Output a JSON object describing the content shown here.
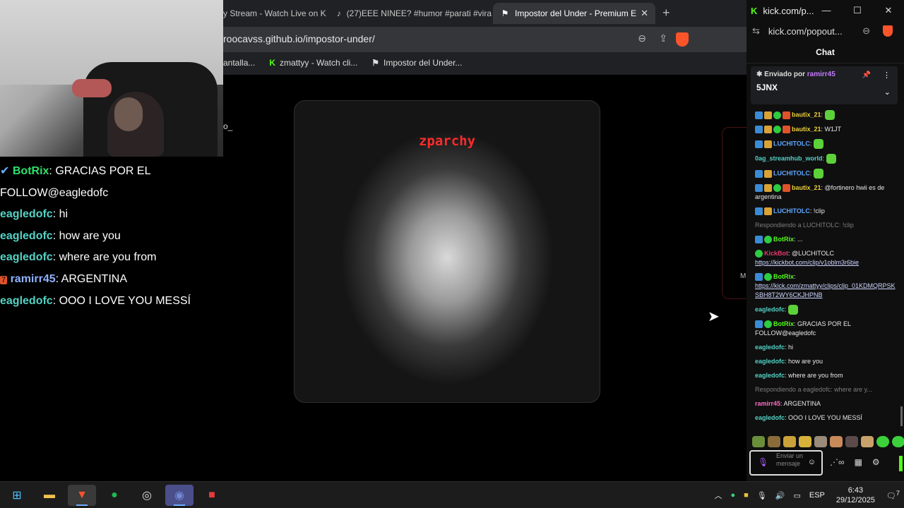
{
  "browser": {
    "tabs": [
      {
        "label": "y Stream - Watch Live on K",
        "icon": "kick-icon"
      },
      {
        "label": "(27)EEE NINEE? #humor #parati #vira",
        "icon": "tiktok-icon"
      },
      {
        "label": "Impostor del Under - Premium E",
        "icon": "game-icon",
        "active": true
      }
    ],
    "url": "roocavss.github.io/impostor-under/",
    "bookmarks": [
      {
        "label": "antalla...",
        "icon": ""
      },
      {
        "label": "zmattyy - Watch cli...",
        "icon": "K"
      },
      {
        "label": "Impostor del Under...",
        "icon": "game-icon"
      }
    ]
  },
  "stray_text": "o_",
  "overlay_chat": [
    {
      "user": "BotRix",
      "prefix": "✔",
      "msg": "GRACIAS POR EL FOLLOW@eagledofc",
      "style": "u2"
    },
    {
      "user": "eagledofc",
      "msg": "hi",
      "style": "u"
    },
    {
      "user": "eagledofc",
      "msg": "how are you",
      "style": "u"
    },
    {
      "user": "eagledofc",
      "msg": "where are you from",
      "style": "u"
    },
    {
      "user": "ramirr45",
      "prefix": "7",
      "msg": "ARGENTINA",
      "style": "u3"
    },
    {
      "user": "eagledofc",
      "msg": "OOO I LOVE YOU MESSÍ",
      "style": "u"
    }
  ],
  "game": {
    "title": "zparchy"
  },
  "ghost_letter": "M",
  "chat_window": {
    "title": "kick.com/p...",
    "address": "kick.com/popout...",
    "header": "Chat",
    "pinned": {
      "sent_by_label": "Enviado por",
      "user": "ramirr45",
      "text": "5JNX"
    },
    "messages": [
      {
        "user": "bautix_21",
        "text": "",
        "color": "n-y",
        "badges": [
          "blue",
          "gold",
          "green",
          "red"
        ],
        "emote": true
      },
      {
        "user": "bautix_21",
        "text": "W1JT",
        "color": "n-y",
        "badges": [
          "blue",
          "gold",
          "green",
          "red"
        ]
      },
      {
        "user": "LUCHITOLC",
        "text": "",
        "color": "n-b",
        "badges": [
          "blue",
          "gold"
        ],
        "emote": true
      },
      {
        "user": "0ag_streamhub_world",
        "text": "",
        "color": "n-t",
        "badges": [],
        "emote": true
      },
      {
        "user": "LUCHITOLC",
        "text": "",
        "color": "n-b",
        "badges": [
          "blue",
          "gold"
        ],
        "emote": true
      },
      {
        "user": "bautix_21",
        "text": "@fortinero hwii es de argentina",
        "color": "n-y",
        "badges": [
          "blue",
          "gold",
          "green",
          "red"
        ]
      },
      {
        "user": "LUCHITOLC",
        "text": "!clip",
        "color": "n-b",
        "badges": [
          "blue",
          "gold"
        ]
      },
      {
        "reply": "Respondiendo a LUCHITOLC: !clip"
      },
      {
        "user": "BotRix",
        "text": "...",
        "color": "n-g",
        "badges": [
          "blue",
          "green"
        ]
      },
      {
        "user": "KickBot",
        "text": "@LUCHITOLC",
        "color": "n-p",
        "badges": [
          "green"
        ],
        "link": "https://kickbot.com/clip/v1oblm3r6bie"
      },
      {
        "user": "BotRix",
        "text": "",
        "color": "n-g",
        "badges": [
          "blue",
          "green"
        ],
        "link": "https://kick.com/zmattyy/clips/clip_01KDMQRPSKSBH8T2WY6CKJHPNB"
      },
      {
        "user": "eagledofc",
        "text": "",
        "color": "n-t",
        "badges": [],
        "emote": true
      },
      {
        "user": "BotRix",
        "text": "GRACIAS POR EL FOLLOW@eagledofc",
        "color": "n-g",
        "badges": [
          "blue",
          "green"
        ]
      },
      {
        "user": "eagledofc",
        "text": "hi",
        "color": "n-t",
        "badges": []
      },
      {
        "user": "eagledofc",
        "text": "how are you",
        "color": "n-t",
        "badges": []
      },
      {
        "user": "eagledofc",
        "text": "where are you from",
        "color": "n-t",
        "badges": []
      },
      {
        "reply": "Respondiendo a eagledofc: where are y..."
      },
      {
        "user": "ramirr45",
        "text": "ARGENTINA",
        "color": "n-m",
        "badges": []
      },
      {
        "user": "eagledofc",
        "text": "OOO I LOVE YOU MESSÍ",
        "color": "n-t",
        "badges": []
      }
    ],
    "input_placeholder": "Enviar un mensaje"
  },
  "taskbar": {
    "language": "ESP",
    "time": "6:43",
    "date": "29/12/2025",
    "notifications": "7"
  }
}
